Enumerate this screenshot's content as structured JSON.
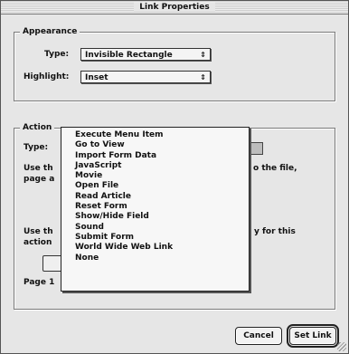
{
  "window": {
    "title": "Link Properties"
  },
  "appearance": {
    "label": "Appearance",
    "type_label": "Type:",
    "type_value": "Invisible Rectangle",
    "highlight_label": "Highlight:",
    "highlight_value": "Inset"
  },
  "action": {
    "label": "Action",
    "type_label": "Type:",
    "text1_left": "Use th",
    "text1_right": "o the file,",
    "text1_line2": "page a",
    "text2_left": "Use th",
    "text2_right": "y for this",
    "text2_line2": "action",
    "page_label": "Page 1"
  },
  "menu": {
    "items": [
      "Execute Menu Item",
      "Go to View",
      "Import Form Data",
      "JavaScript",
      "Movie",
      "Open File",
      "Read Article",
      "Reset Form",
      "Show/Hide Field",
      "Sound",
      "Submit Form",
      "World Wide Web Link",
      "None"
    ]
  },
  "buttons": {
    "cancel": "Cancel",
    "set_link": "Set Link"
  },
  "icons": {
    "popup_arrows": "⇕"
  }
}
